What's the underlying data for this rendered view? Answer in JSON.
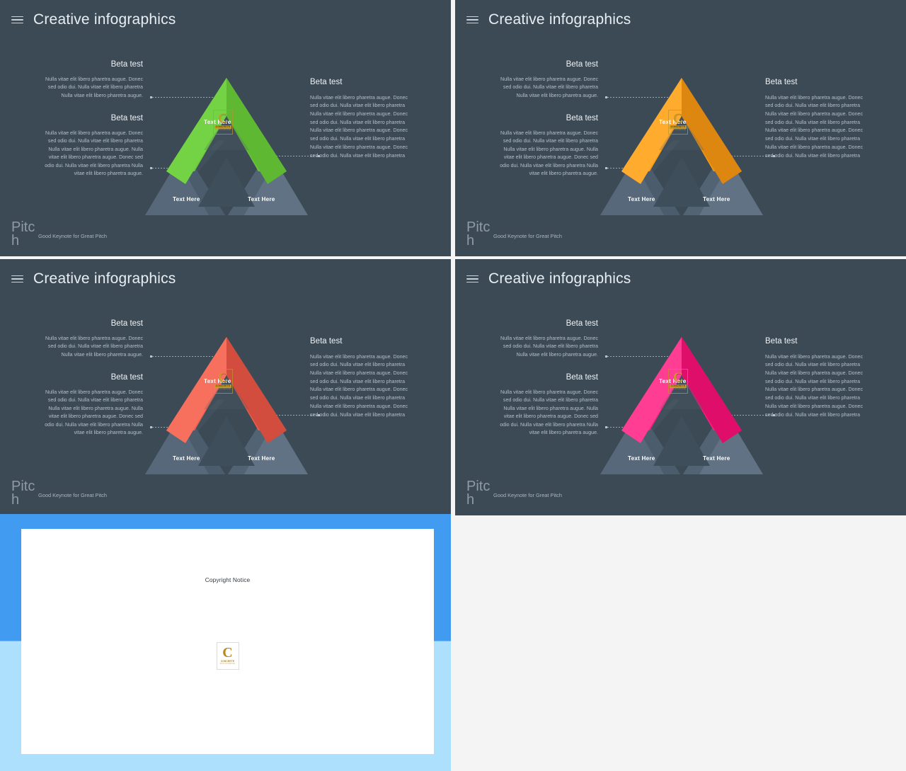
{
  "page": {
    "background": "#f4f4f4",
    "slide_background": "#3c4a56"
  },
  "slides": [
    {
      "id": "slide-green",
      "accent": "#69c639",
      "accent_dark": "#57ab2c",
      "accent_light": "#7ad84a",
      "header": {
        "title": "Creative infographics",
        "menu_icon": "hamburger-icon"
      },
      "left_column": {
        "blocks": [
          {
            "heading": "Beta test",
            "body": "Nulla vitae elit libero pharetra augue. Donec sed odio dui. Nulla vitae elit libero pharetra Nulla vitae elit libero pharetra augue."
          },
          {
            "heading": "Beta test",
            "body": "Nulla vitae elit libero pharetra augue. Donec sed odio dui. Nulla vitae elit libero pharetra Nulla vitae elit libero pharetra augue. Nulla vitae elit libero pharetra augue. Donec sed odio dui. Nulla vitae elit libero pharetra Nulla vitae elit libero pharetra augue."
          }
        ]
      },
      "right_column": {
        "heading": "Beta test",
        "body": "Nulla vitae elit libero pharetra augue. Donec sed odio dui. Nulla vitae elit libero pharetra Nulla vitae elit libero pharetra augue. Donec sed odio dui. Nulla vitae elit libero pharetra Nulla vitae elit libero pharetra augue. Donec sed odio dui. Nulla vitae elit libero pharetra Nulla vitae elit libero pharetra augue. Donec sed odio dui. Nulla vitae elit libero pharetra"
      },
      "graphic": {
        "top_label": "Text Here",
        "bottom_left_label": "Text Here",
        "bottom_right_label": "Text Here",
        "watermark": {
          "letter": "C",
          "band": "CONCRETE",
          "sub": "MULTIPURPOSE"
        }
      },
      "footer": {
        "brand": "Pitch",
        "tagline": "Good Keynote for Great Pitch"
      }
    },
    {
      "id": "slide-orange",
      "accent": "#f49a18",
      "accent_dark": "#dd8610",
      "accent_light": "#ffab2e",
      "header": {
        "title": "Creative infographics",
        "menu_icon": "hamburger-icon"
      },
      "left_column": {
        "blocks": [
          {
            "heading": "Beta test",
            "body": "Nulla vitae elit libero pharetra augue. Donec sed odio dui. Nulla vitae elit libero pharetra Nulla vitae elit libero pharetra augue."
          },
          {
            "heading": "Beta test",
            "body": "Nulla vitae elit libero pharetra augue. Donec sed odio dui. Nulla vitae elit libero pharetra Nulla vitae elit libero pharetra augue. Nulla vitae elit libero pharetra augue. Donec sed odio dui. Nulla vitae elit libero pharetra Nulla vitae elit libero pharetra augue."
          }
        ]
      },
      "right_column": {
        "heading": "Beta test",
        "body": "Nulla vitae elit libero pharetra augue. Donec sed odio dui. Nulla vitae elit libero pharetra Nulla vitae elit libero pharetra augue. Donec sed odio dui. Nulla vitae elit libero pharetra Nulla vitae elit libero pharetra augue. Donec sed odio dui. Nulla vitae elit libero pharetra Nulla vitae elit libero pharetra augue. Donec sed odio dui. Nulla vitae elit libero pharetra"
      },
      "graphic": {
        "top_label": "Text Here",
        "bottom_left_label": "Text Here",
        "bottom_right_label": "Text Here",
        "watermark": {
          "letter": "C",
          "band": "CONCRETE",
          "sub": "MULTIPURPOSE"
        }
      },
      "footer": {
        "brand": "Pitch",
        "tagline": "Good Keynote for Great Pitch"
      }
    },
    {
      "id": "slide-red",
      "accent": "#eb5e4c",
      "accent_dark": "#d24d3d",
      "accent_light": "#f7705e",
      "header": {
        "title": "Creative infographics",
        "menu_icon": "hamburger-icon"
      },
      "left_column": {
        "blocks": [
          {
            "heading": "Beta test",
            "body": "Nulla vitae elit libero pharetra augue. Donec sed odio dui. Nulla vitae elit libero pharetra Nulla vitae elit libero pharetra augue."
          },
          {
            "heading": "Beta test",
            "body": "Nulla vitae elit libero pharetra augue. Donec sed odio dui. Nulla vitae elit libero pharetra Nulla vitae elit libero pharetra augue. Nulla vitae elit libero pharetra augue. Donec sed odio dui. Nulla vitae elit libero pharetra Nulla vitae elit libero pharetra augue."
          }
        ]
      },
      "right_column": {
        "heading": "Beta test",
        "body": "Nulla vitae elit libero pharetra augue. Donec sed odio dui. Nulla vitae elit libero pharetra Nulla vitae elit libero pharetra augue. Donec sed odio dui. Nulla vitae elit libero pharetra Nulla vitae elit libero pharetra augue. Donec sed odio dui. Nulla vitae elit libero pharetra Nulla vitae elit libero pharetra augue. Donec sed odio dui. Nulla vitae elit libero pharetra"
      },
      "graphic": {
        "top_label": "Text Here",
        "bottom_left_label": "Text Here",
        "bottom_right_label": "Text Here",
        "watermark": {
          "letter": "C",
          "band": "CONCRETE",
          "sub": "MULTIPURPOSE"
        }
      },
      "footer": {
        "brand": "Pitch",
        "tagline": "Good Keynote for Great Pitch"
      }
    },
    {
      "id": "slide-pink",
      "accent": "#fc1f7e",
      "accent_dark": "#e00e6b",
      "accent_light": "#ff3d92",
      "header": {
        "title": "Creative infographics",
        "menu_icon": "hamburger-icon"
      },
      "left_column": {
        "blocks": [
          {
            "heading": "Beta test",
            "body": "Nulla vitae elit libero pharetra augue. Donec sed odio dui. Nulla vitae elit libero pharetra Nulla vitae elit libero pharetra augue."
          },
          {
            "heading": "Beta test",
            "body": "Nulla vitae elit libero pharetra augue. Donec sed odio dui. Nulla vitae elit libero pharetra Nulla vitae elit libero pharetra augue. Nulla vitae elit libero pharetra augue. Donec sed odio dui. Nulla vitae elit libero pharetra Nulla vitae elit libero pharetra augue."
          }
        ]
      },
      "right_column": {
        "heading": "Beta test",
        "body": "Nulla vitae elit libero pharetra augue. Donec sed odio dui. Nulla vitae elit libero pharetra Nulla vitae elit libero pharetra augue. Donec sed odio dui. Nulla vitae elit libero pharetra Nulla vitae elit libero pharetra augue. Donec sed odio dui. Nulla vitae elit libero pharetra Nulla vitae elit libero pharetra augue. Donec sed odio dui. Nulla vitae elit libero pharetra"
      },
      "graphic": {
        "top_label": "Text Here",
        "bottom_left_label": "Text Here",
        "bottom_right_label": "Text Here",
        "watermark": {
          "letter": "C",
          "band": "CONCRETE",
          "sub": "MULTIPURPOSE"
        }
      },
      "footer": {
        "brand": "Pitch",
        "tagline": "Good Keynote for Great Pitch"
      }
    }
  ],
  "copyright_panel": {
    "title": "Copyright Notice",
    "border_top_color": "#419bf0",
    "border_bottom_color": "#ace0fd",
    "logo": {
      "letter": "C",
      "band": "CONCRETE",
      "sub": "MULTIPURPOSE"
    }
  }
}
